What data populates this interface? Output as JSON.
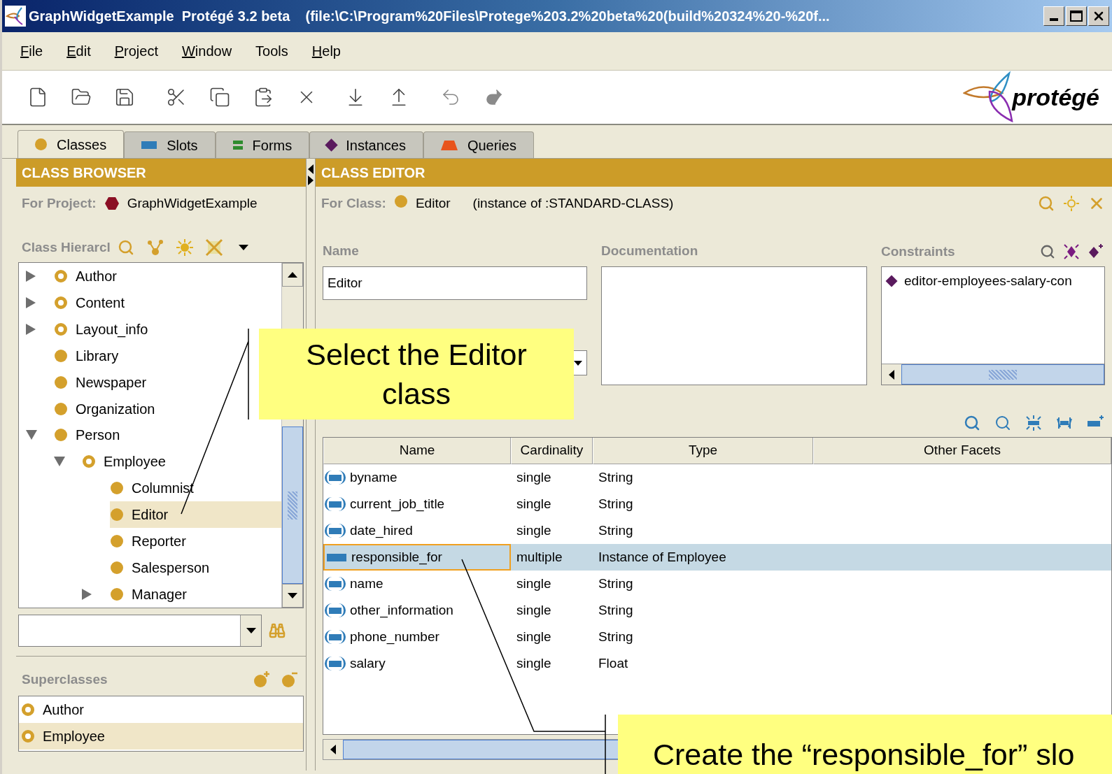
{
  "window": {
    "title": "GraphWidgetExample  Protégé 3.2 beta    (file:\\C:\\Program%20Files\\Protege%203.2%20beta%20(build%20324%20-%20f..."
  },
  "menu": [
    {
      "label": "File",
      "underlined": true
    },
    {
      "label": "Edit",
      "underlined": true
    },
    {
      "label": "Project",
      "underlined": true
    },
    {
      "label": "Window",
      "underlined": true
    },
    {
      "label": "Tools",
      "underlined": false
    },
    {
      "label": "Help",
      "underlined": true
    }
  ],
  "logo": {
    "text": "protégé"
  },
  "tabs": [
    {
      "label": "Classes",
      "kind": "class",
      "selected": true
    },
    {
      "label": "Slots",
      "kind": "slot",
      "selected": false
    },
    {
      "label": "Forms",
      "kind": "form",
      "selected": false
    },
    {
      "label": "Instances",
      "kind": "instance",
      "selected": false
    },
    {
      "label": "Queries",
      "kind": "query",
      "selected": false
    }
  ],
  "class_browser": {
    "header": "CLASS BROWSER",
    "project_label": "For Project:",
    "project": "GraphWidgetExample",
    "hierarchy_label": "Class Hierarcl",
    "tree": [
      {
        "name": "Author",
        "expanded": false,
        "abstract": true,
        "selected": false
      },
      {
        "name": "Content",
        "expanded": false,
        "abstract": true,
        "selected": false
      },
      {
        "name": "Layout_info",
        "expanded": false,
        "abstract": true,
        "selected": false
      },
      {
        "name": "Library",
        "abstract": false,
        "selected": false
      },
      {
        "name": "Newspaper",
        "abstract": false,
        "selected": false
      },
      {
        "name": "Organization",
        "abstract": false,
        "selected": false
      },
      {
        "name": "Person",
        "expanded": true,
        "abstract": false,
        "selected": false,
        "children": [
          {
            "name": "Employee",
            "expanded": true,
            "abstract": true,
            "selected": false,
            "children": [
              {
                "name": "Columnist",
                "abstract": false,
                "selected": false
              },
              {
                "name": "Editor",
                "abstract": false,
                "selected": true
              },
              {
                "name": "Reporter",
                "abstract": false,
                "selected": false
              },
              {
                "name": "Salesperson",
                "abstract": false,
                "selected": false
              },
              {
                "name": "Manager",
                "expanded": false,
                "abstract": false,
                "selected": false
              }
            ]
          }
        ]
      }
    ],
    "superclasses_label": "Superclasses",
    "superclasses": [
      {
        "name": "Author",
        "selected": false
      },
      {
        "name": "Employee",
        "selected": true
      }
    ]
  },
  "class_editor": {
    "header": "CLASS EDITOR",
    "class_label": "For Class:",
    "class_name": "Editor",
    "instance_of": "(instance of :STANDARD-CLASS)",
    "name_label": "Name",
    "name_value": "Editor",
    "documentation_label": "Documentation",
    "constraints_label": "Constraints",
    "constraints": [
      "editor-employees-salary-con"
    ],
    "columns": [
      "Name",
      "Cardinality",
      "Type",
      "Other Facets"
    ],
    "slots": [
      {
        "name": "byname",
        "cardinality": "single",
        "type": "String",
        "inherited": true,
        "selected": false
      },
      {
        "name": "current_job_title",
        "cardinality": "single",
        "type": "String",
        "inherited": true,
        "selected": false
      },
      {
        "name": "date_hired",
        "cardinality": "single",
        "type": "String",
        "inherited": true,
        "selected": false
      },
      {
        "name": "responsible_for",
        "cardinality": "multiple",
        "type": "Instance of Employee",
        "inherited": false,
        "selected": true
      },
      {
        "name": "name",
        "cardinality": "single",
        "type": "String",
        "inherited": true,
        "selected": false
      },
      {
        "name": "other_information",
        "cardinality": "single",
        "type": "String",
        "inherited": true,
        "selected": false
      },
      {
        "name": "phone_number",
        "cardinality": "single",
        "type": "String",
        "inherited": true,
        "selected": false
      },
      {
        "name": "salary",
        "cardinality": "single",
        "type": "Float",
        "inherited": true,
        "selected": false
      }
    ]
  },
  "callouts": [
    {
      "lines": [
        "Select the Editor",
        "class"
      ]
    },
    {
      "lines": [
        "Create the “responsible_for” slo"
      ]
    }
  ]
}
